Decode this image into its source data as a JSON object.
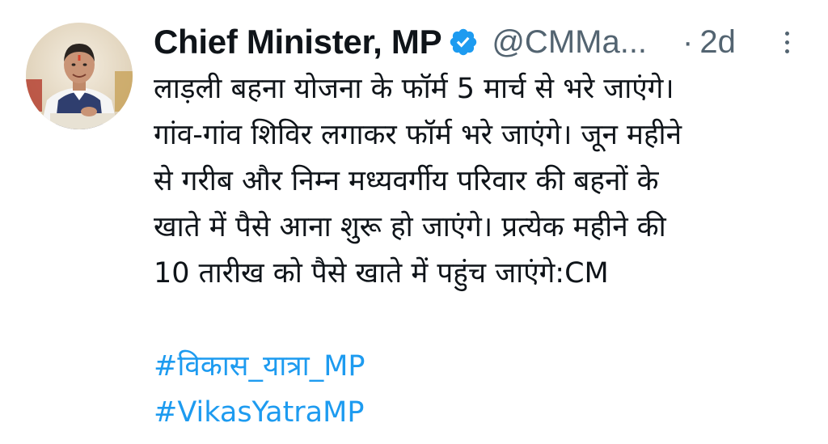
{
  "tweet": {
    "author": {
      "display_name": "Chief Minister, MP",
      "handle": "@CMMa...",
      "verified_icon": "verified-badge-icon",
      "avatar_icon": "avatar"
    },
    "separator": "·",
    "time": "2d",
    "more_icon": "more-options-icon",
    "body_lines": [
      "लाड़ली बहना योजना के फॉर्म 5 मार्च से भरे जाएंगे।",
      "गांव-गांव शिविर लगाकर फॉर्म भरे जाएंगे। जून महीने",
      "से गरीब और निम्न मध्यवर्गीय परिवार की बहनों के",
      "खाते में पैसे आना शुरू हो जाएंगे। प्रत्येक महीने की",
      "10 तारीख को पैसे खाते में पहुंच जाएंगे:CM"
    ],
    "hashtags": [
      "#विकास_यात्रा_MP",
      "#VikasYatraMP"
    ]
  },
  "colors": {
    "text": "#0f1419",
    "secondary": "#536471",
    "link": "#1d9bf0",
    "verified": "#1d9bf0"
  }
}
